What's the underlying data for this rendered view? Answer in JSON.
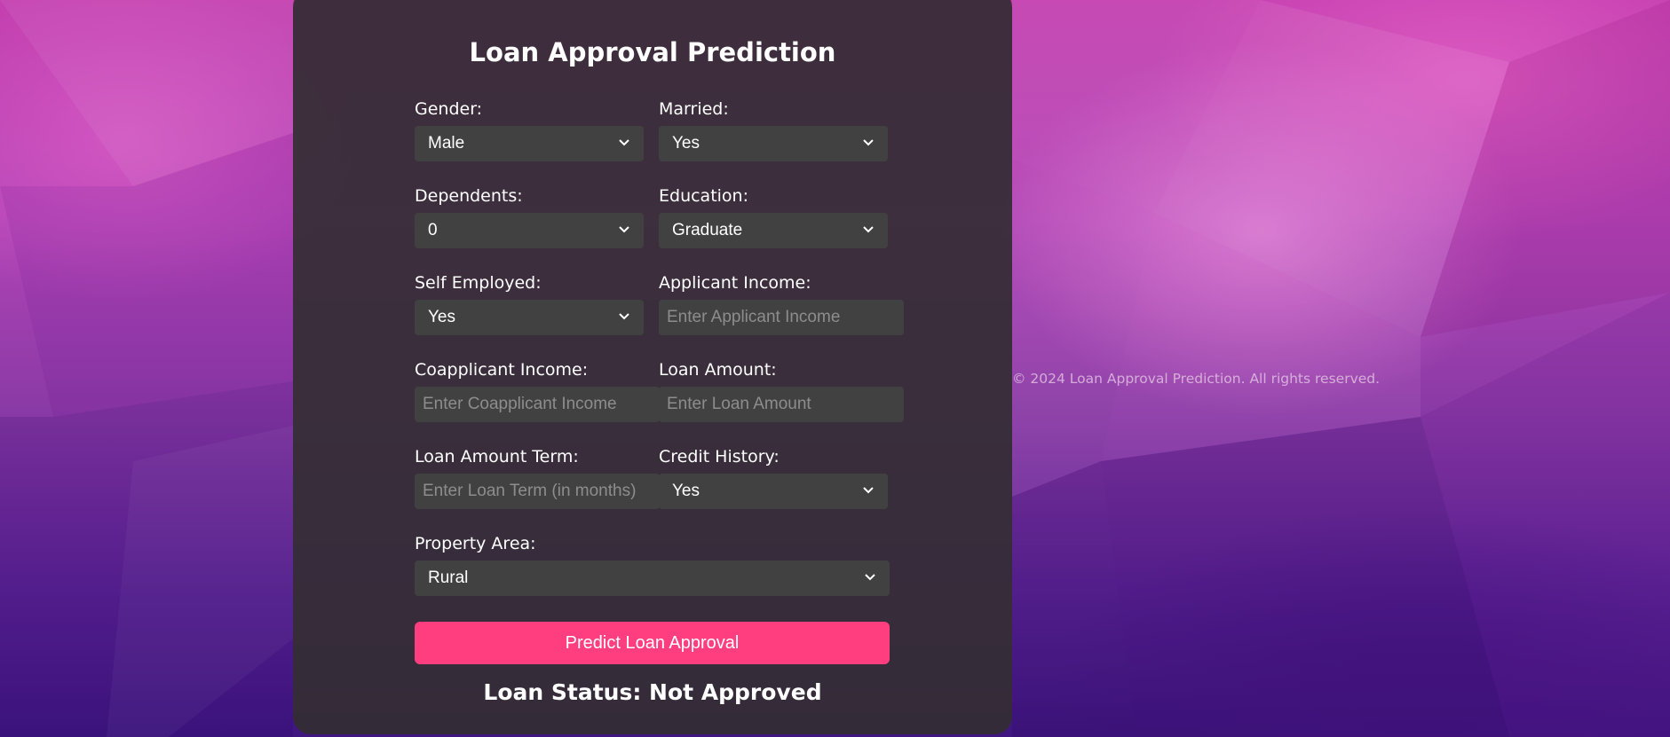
{
  "page_title": "Loan Approval Prediction",
  "form": {
    "gender": {
      "label": "Gender:",
      "value": "Male"
    },
    "married": {
      "label": "Married:",
      "value": "Yes"
    },
    "dependents": {
      "label": "Dependents:",
      "value": "0"
    },
    "education": {
      "label": "Education:",
      "value": "Graduate"
    },
    "self_employed": {
      "label": "Self Employed:",
      "value": "Yes"
    },
    "applicant_income": {
      "label": "Applicant Income:",
      "placeholder": "Enter Applicant Income"
    },
    "coapplicant_income": {
      "label": "Coapplicant Income:",
      "placeholder": "Enter Coapplicant Income"
    },
    "loan_amount": {
      "label": "Loan Amount:",
      "placeholder": "Enter Loan Amount"
    },
    "loan_amount_term": {
      "label": "Loan Amount Term:",
      "placeholder": "Enter Loan Term (in months)"
    },
    "credit_history": {
      "label": "Credit History:",
      "value": "Yes"
    },
    "property_area": {
      "label": "Property Area:",
      "value": "Rural"
    }
  },
  "predict_button": "Predict Loan Approval",
  "result": {
    "status_text": "Loan Status: Not Approved"
  },
  "footer": "© 2024 Loan Approval Prediction. All rights reserved.",
  "colors": {
    "accent": "#ff3e7f",
    "card": "#342d34",
    "field": "#414141"
  },
  "icons": {
    "dropdown": "chevron-down-icon"
  }
}
